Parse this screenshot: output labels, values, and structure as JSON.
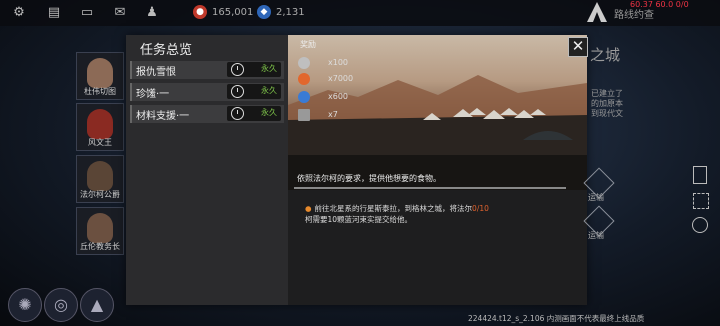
{
  "topbar": {
    "icons": [
      "gear-icon",
      "chat-icon",
      "keyboard-icon",
      "mail-icon",
      "user-icon"
    ],
    "resource1": "165,001",
    "resource2": "2,131",
    "corner_title": "路线约查",
    "corner_info": "60.37 60.0 0/0"
  },
  "characters": [
    {
      "name": "杜伟切图"
    },
    {
      "name": "风文王"
    },
    {
      "name": "法尔柯公爵"
    },
    {
      "name": "丘伦教务长"
    }
  ],
  "panel": {
    "title": "任务总览",
    "tasks": [
      {
        "label": "报仇雪恨",
        "duration": "永久"
      },
      {
        "label": "珍馐·一",
        "duration": "永久"
      },
      {
        "label": "材料支援·一",
        "duration": "永久"
      }
    ]
  },
  "scene": {
    "title": "奖励",
    "close": "✕",
    "rewards": [
      {
        "icon": "document-icon",
        "amount": "x100",
        "color": "#bfbfbf"
      },
      {
        "icon": "coin-icon",
        "amount": "x7000",
        "color": "#e2672d"
      },
      {
        "icon": "gem-icon",
        "amount": "x600",
        "color": "#3a7bd5"
      },
      {
        "icon": "list-icon",
        "amount": "x7",
        "color": "#999999"
      }
    ],
    "description": "依照法尔柯的要求，提供他想要的食物。"
  },
  "objective": {
    "text_before": "前往北星系的行星斯泰拉，到格林之城，将法尔",
    "progress": "0/10",
    "text_after": "柯需要10颗蓝河束实提交给他。"
  },
  "right": {
    "title": "之城",
    "text": "已建立了\n的加原本\n到现代文",
    "button1": "运输",
    "button2": "运输"
  },
  "footer": "224424.t12_s_2.106 内测画面不代表最终上线品质"
}
